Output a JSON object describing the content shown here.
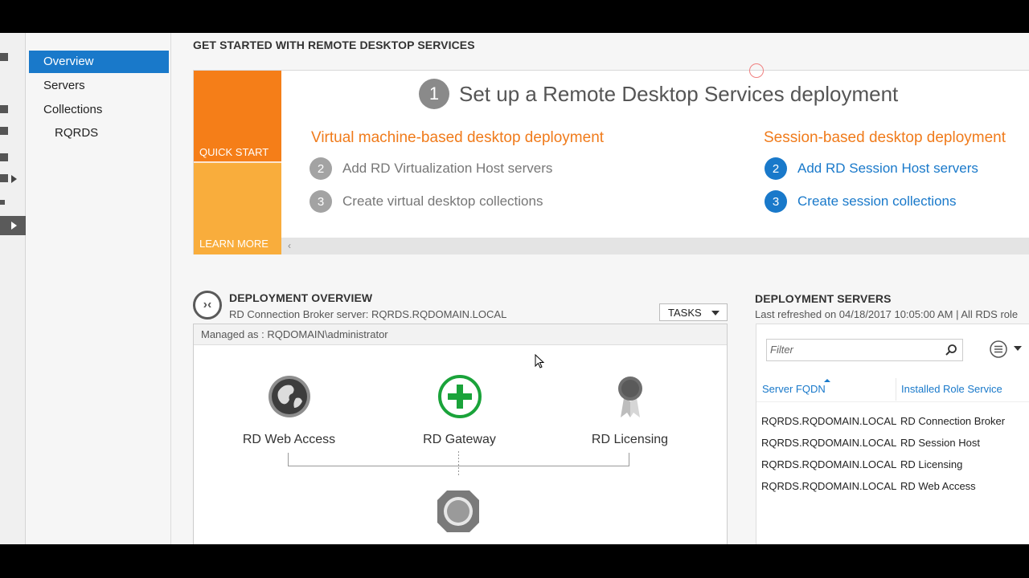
{
  "nav": {
    "items": [
      {
        "label": "Overview"
      },
      {
        "label": "Servers"
      },
      {
        "label": "Collections"
      },
      {
        "label": "RQRDS"
      }
    ]
  },
  "quick_start": {
    "section_title": "GET STARTED WITH REMOTE DESKTOP SERVICES",
    "tile_quick_start": "QUICK START",
    "tile_learn_more": "LEARN MORE",
    "step1_number": "1",
    "headline": "Set up a Remote Desktop Services deployment",
    "vm_title": "Virtual machine-based desktop deployment",
    "vm_steps": [
      {
        "num": "2",
        "label": "Add RD Virtualization Host servers"
      },
      {
        "num": "3",
        "label": "Create virtual desktop collections"
      }
    ],
    "session_title": "Session-based desktop deployment",
    "session_steps": [
      {
        "num": "2",
        "label": "Add RD Session Host servers"
      },
      {
        "num": "3",
        "label": "Create session collections"
      }
    ]
  },
  "overview": {
    "title": "DEPLOYMENT OVERVIEW",
    "broker_line": "RD Connection Broker server: RQRDS.RQDOMAIN.LOCAL",
    "tasks_label": "TASKS",
    "managed_as": "Managed as : RQDOMAIN\\administrator",
    "roles": {
      "web_access": "RD Web Access",
      "gateway": "RD Gateway",
      "licensing": "RD Licensing"
    }
  },
  "servers": {
    "title": "DEPLOYMENT SERVERS",
    "refreshed": "Last refreshed on 04/18/2017 10:05:00 AM | All RDS role",
    "filter_placeholder": "Filter",
    "columns": [
      "Server FQDN",
      "Installed Role Service"
    ],
    "rows": [
      [
        "RQRDS.RQDOMAIN.LOCAL",
        "RD Connection Broker"
      ],
      [
        "RQRDS.RQDOMAIN.LOCAL",
        "RD Session Host"
      ],
      [
        "RQRDS.RQDOMAIN.LOCAL",
        "RD Licensing"
      ],
      [
        "RQRDS.RQDOMAIN.LOCAL",
        "RD Web Access"
      ]
    ]
  },
  "colors": {
    "accent_blue": "#1979ca",
    "orange_title": "#f07b1b",
    "tile_orange": "#f57e18",
    "tile_amber": "#f9ad3c",
    "gateway_green": "#1aa33a"
  }
}
